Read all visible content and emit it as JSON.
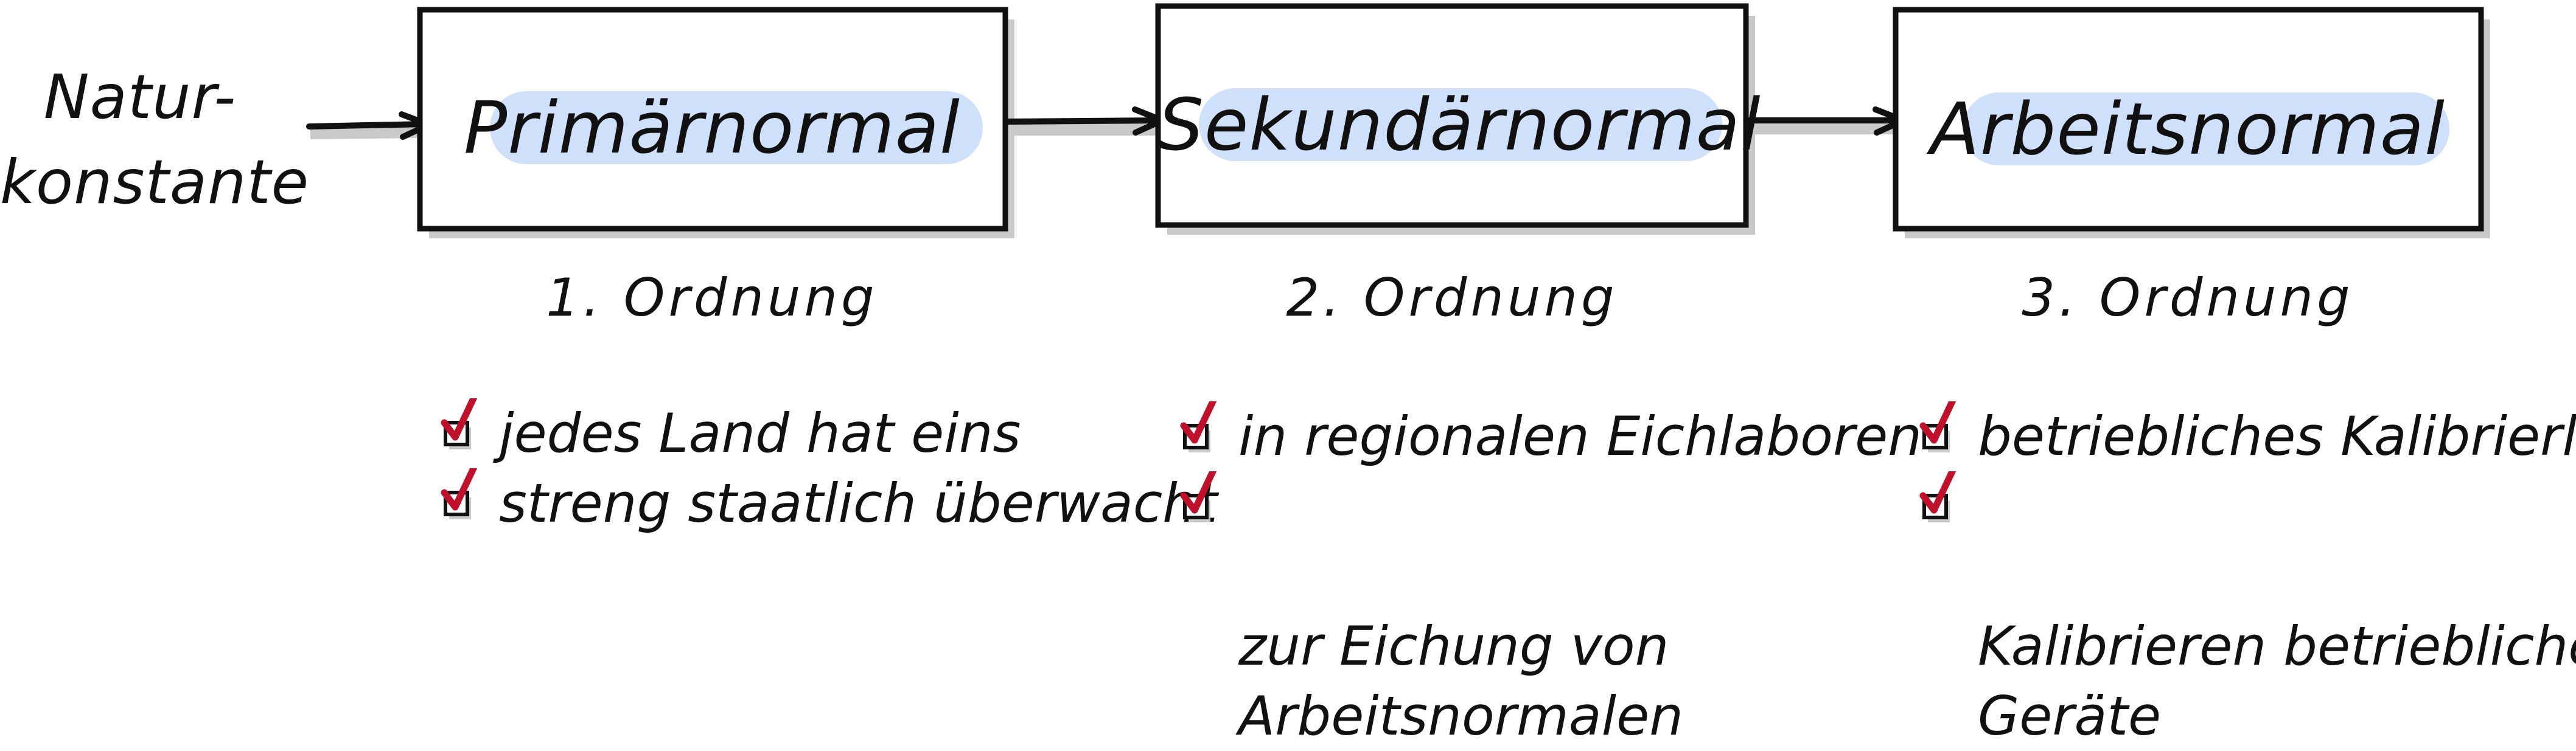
{
  "source": {
    "label": "Natur-\nkonstante"
  },
  "nodes": [
    {
      "title": "Primärnormal",
      "order": "1. Ordnung",
      "bullets": [
        "jedes Land hat eins",
        "streng staatlich überwacht"
      ]
    },
    {
      "title": "Sekundärnormal",
      "order": "2. Ordnung",
      "bullets": [
        "in regionalen Eichlaboren",
        "zur Eichung von\nArbeitsnormalen"
      ]
    },
    {
      "title": "Arbeitsnormal",
      "order": "3. Ordnung",
      "bullets": [
        "betriebliches Kalibrierlabor",
        "Kalibrieren betrieblicher\nGeräte"
      ]
    }
  ],
  "colors": {
    "highlight": "#cfe0fb",
    "check": "#c0102a",
    "shadow": "#c9c9c9",
    "stroke": "#111111"
  }
}
